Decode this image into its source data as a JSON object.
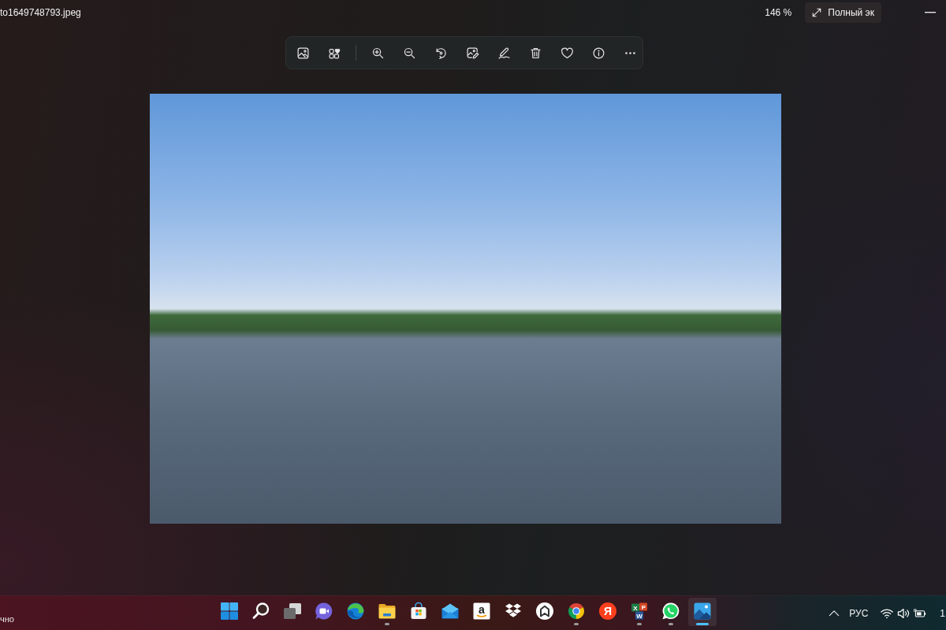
{
  "window": {
    "title": "to1649748793.jpeg",
    "zoom": "146 %",
    "fullscreen_button": "Полный эк"
  },
  "taskbar": {
    "status_text": "чно",
    "apps": [
      {
        "kind": "start",
        "running": false,
        "selected": false
      },
      {
        "kind": "search",
        "running": false,
        "selected": false
      },
      {
        "kind": "task-view",
        "running": false,
        "selected": false
      },
      {
        "kind": "chat",
        "running": false,
        "selected": false
      },
      {
        "kind": "browser-swirl",
        "running": false,
        "selected": false
      },
      {
        "kind": "folder",
        "running": true,
        "selected": false
      },
      {
        "kind": "store",
        "running": false,
        "selected": false
      },
      {
        "kind": "mail",
        "running": false,
        "selected": false
      },
      {
        "kind": "letter-tile",
        "glyph": "a",
        "running": false,
        "selected": false
      },
      {
        "kind": "boxes",
        "running": false,
        "selected": false
      },
      {
        "kind": "house",
        "running": false,
        "selected": false
      },
      {
        "kind": "browser-ring",
        "running": true,
        "selected": false
      },
      {
        "kind": "letter-circle",
        "glyph": "Я",
        "running": false,
        "selected": false
      },
      {
        "kind": "office-tiles",
        "glyphs": [
          "X",
          "P",
          "W"
        ],
        "running": true,
        "selected": false
      },
      {
        "kind": "phone-bubble",
        "running": true,
        "selected": false
      },
      {
        "kind": "photos",
        "running": true,
        "selected": true
      }
    ],
    "tray": {
      "language": "РУС",
      "clock": "1"
    }
  }
}
